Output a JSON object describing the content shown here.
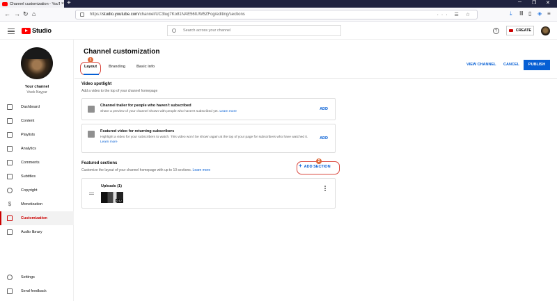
{
  "browser": {
    "tab_title": "Channel customization - YouTube",
    "tab_close": "×",
    "new_tab": "+",
    "url_domain": "studio.youtube.com",
    "url_prefix": "https://",
    "url_path": "/channel/UC3lug7Ko81NAE56IUW5ZFog/editing/sections",
    "url_right_icons": "··· ☰ ☆",
    "win_min": "─",
    "win_max": "❐",
    "win_close": "✕"
  },
  "header": {
    "logo_text": "Studio",
    "search_placeholder": "Search across your channel",
    "help_glyph": "?",
    "create_label": "CREATE"
  },
  "sidebar": {
    "channel_label": "Your channel",
    "channel_owner": "Vivek Nayyar",
    "items": [
      {
        "label": "Dashboard",
        "icon": "dashboard-icon"
      },
      {
        "label": "Content",
        "icon": "content-icon"
      },
      {
        "label": "Playlists",
        "icon": "playlists-icon"
      },
      {
        "label": "Analytics",
        "icon": "analytics-icon"
      },
      {
        "label": "Comments",
        "icon": "comments-icon"
      },
      {
        "label": "Subtitles",
        "icon": "subtitles-icon"
      },
      {
        "label": "Copyright",
        "icon": "copyright-icon"
      },
      {
        "label": "Monetization",
        "icon": "monetization-icon"
      },
      {
        "label": "Customization",
        "icon": "customization-icon",
        "active": true
      },
      {
        "label": "Audio library",
        "icon": "audio-library-icon"
      }
    ],
    "bottom": [
      {
        "label": "Settings",
        "icon": "settings-icon"
      },
      {
        "label": "Send feedback",
        "icon": "feedback-icon"
      }
    ]
  },
  "main": {
    "title": "Channel customization",
    "tabs": [
      {
        "label": "Layout",
        "active": true
      },
      {
        "label": "Branding"
      },
      {
        "label": "Basic info"
      }
    ],
    "view_channel": "VIEW CHANNEL",
    "cancel": "CANCEL",
    "publish": "PUBLISH",
    "badge_1": "1",
    "badge_2": "2",
    "video_spotlight": {
      "title": "Video spotlight",
      "desc": "Add a video to the top of your channel homepage",
      "trailer": {
        "title": "Channel trailer for people who haven't subscribed",
        "desc": "Share a preview of your channel shown with people who haven't subscribed yet.",
        "link": "Learn more",
        "action": "ADD"
      },
      "featured": {
        "title": "Featured video for returning subscribers",
        "desc": "Highlight a video for your subscribers to watch. This video won't be shown again at the top of your page for subscribers who have watched it.",
        "link": "Learn more",
        "action": "ADD"
      }
    },
    "featured_sections": {
      "title": "Featured sections",
      "desc": "Customize the layout of your channel homepage with up to 10 sections.",
      "link": "Learn more",
      "add_section": "ADD SECTION",
      "add_glyph": "+",
      "uploads": {
        "title": "Uploads (1)",
        "duration": "0:12"
      }
    }
  },
  "colors": {
    "accent_blue": "#065fd4",
    "brand_red": "#ff0000",
    "highlight": "#d9453b"
  }
}
